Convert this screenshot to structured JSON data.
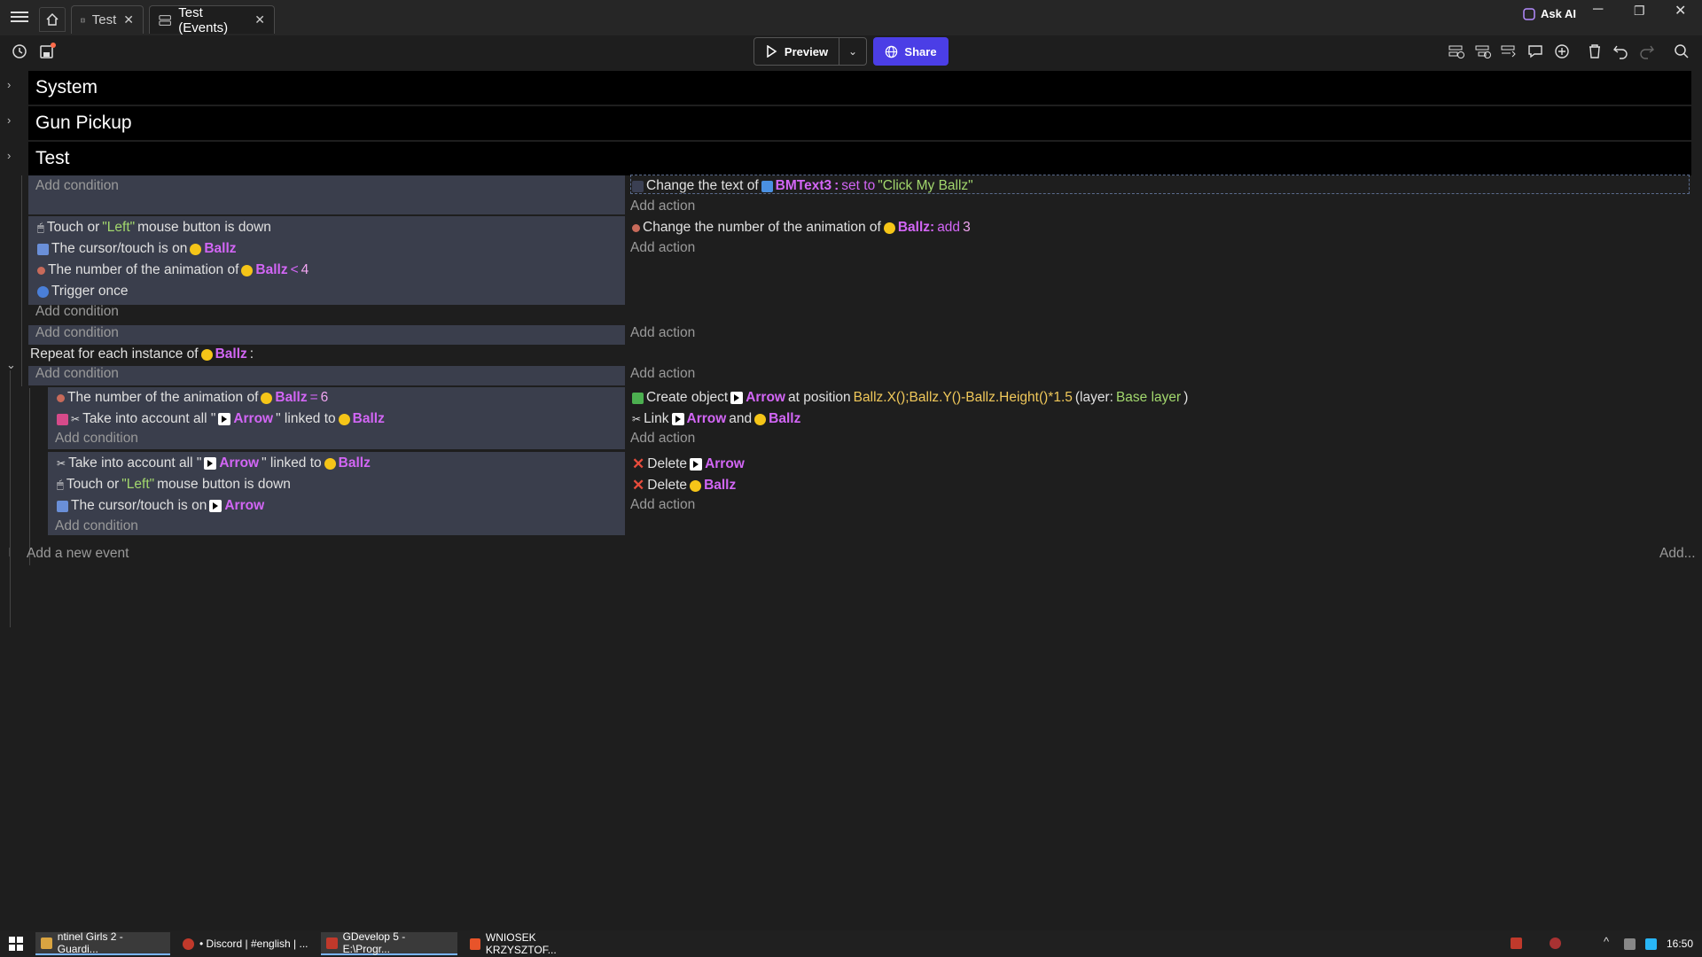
{
  "titlebar": {
    "tabs": [
      {
        "label": "Test",
        "icon": "film-icon"
      },
      {
        "label": "Test (Events)",
        "icon": "events-icon"
      }
    ],
    "ask_ai": "Ask AI"
  },
  "toolbar": {
    "preview": "Preview",
    "share": "Share"
  },
  "groups": [
    "System",
    "Gun Pickup",
    "Test"
  ],
  "event1": {
    "add_condition": "Add condition",
    "action_text": "Change the text of",
    "action_obj": "BMText3",
    "action_op": "set to",
    "action_val": "\"Click My Ballz\"",
    "add_action": "Add action"
  },
  "event2": {
    "c1_a": "Touch or",
    "c1_b": "\"Left\"",
    "c1_c": "mouse button is down",
    "c2_a": "The cursor/touch is on",
    "c2_obj": "Ballz",
    "c3_a": "The number of the animation of",
    "c3_obj": "Ballz",
    "c3_op": "<",
    "c3_val": "4",
    "c4_a": "Trigger once",
    "add_condition": "Add condition",
    "a1_a": "Change the number of the animation of",
    "a1_obj": "Ballz:",
    "a1_op": "add",
    "a1_val": "3",
    "add_action": "Add action"
  },
  "event3": {
    "add_condition": "Add condition",
    "add_action": "Add action"
  },
  "repeat": {
    "label": "Repeat for each instance of",
    "obj": "Ballz",
    "colon": ":",
    "add_condition": "Add condition",
    "add_action": "Add action"
  },
  "sub1": {
    "c1_a": "The number of the animation of",
    "c1_obj": "Ballz",
    "c1_op": "=",
    "c1_val": "6",
    "c2_a": "Take into account all \"",
    "c2_obj": "Arrow",
    "c2_b": "\" linked to",
    "c2_obj2": "Ballz",
    "add_condition": "Add condition",
    "a1_a": "Create object",
    "a1_obj": "Arrow",
    "a1_b": "at position",
    "a1_expr": "Ballz.X();Ballz.Y()-Ballz.Height()*1.5",
    "a1_c": "(layer:",
    "a1_layer": "Base layer",
    "a1_d": ")",
    "a2_a": "Link",
    "a2_obj": "Arrow",
    "a2_b": "and",
    "a2_obj2": "Ballz",
    "add_action": "Add action"
  },
  "sub2": {
    "c1_a": "Take into account all \"",
    "c1_obj": "Arrow",
    "c1_b": "\" linked to",
    "c1_obj2": "Ballz",
    "c2_a": "Touch or",
    "c2_b": "\"Left\"",
    "c2_c": "mouse button is down",
    "c3_a": "The cursor/touch is on",
    "c3_obj": "Arrow",
    "add_condition": "Add condition",
    "a1_a": "Delete",
    "a1_obj": "Arrow",
    "a2_a": "Delete",
    "a2_obj": "Ballz",
    "add_action": "Add action"
  },
  "footer": {
    "add_event": "Add a new event",
    "add": "Add..."
  },
  "taskbar": {
    "items": [
      "ntinel Girls 2 - Guardi...",
      "• Discord | #english | ...",
      "GDevelop 5 - E:\\Progr...",
      "WNIOSEK KRZYSZTOF..."
    ],
    "clock": "16:50"
  },
  "colors": {
    "accent": "#4b3ee6",
    "object": "#d266f5",
    "string": "#a2d76d",
    "condition_bg": "#3a3e4c",
    "group_bg": "#000000"
  }
}
